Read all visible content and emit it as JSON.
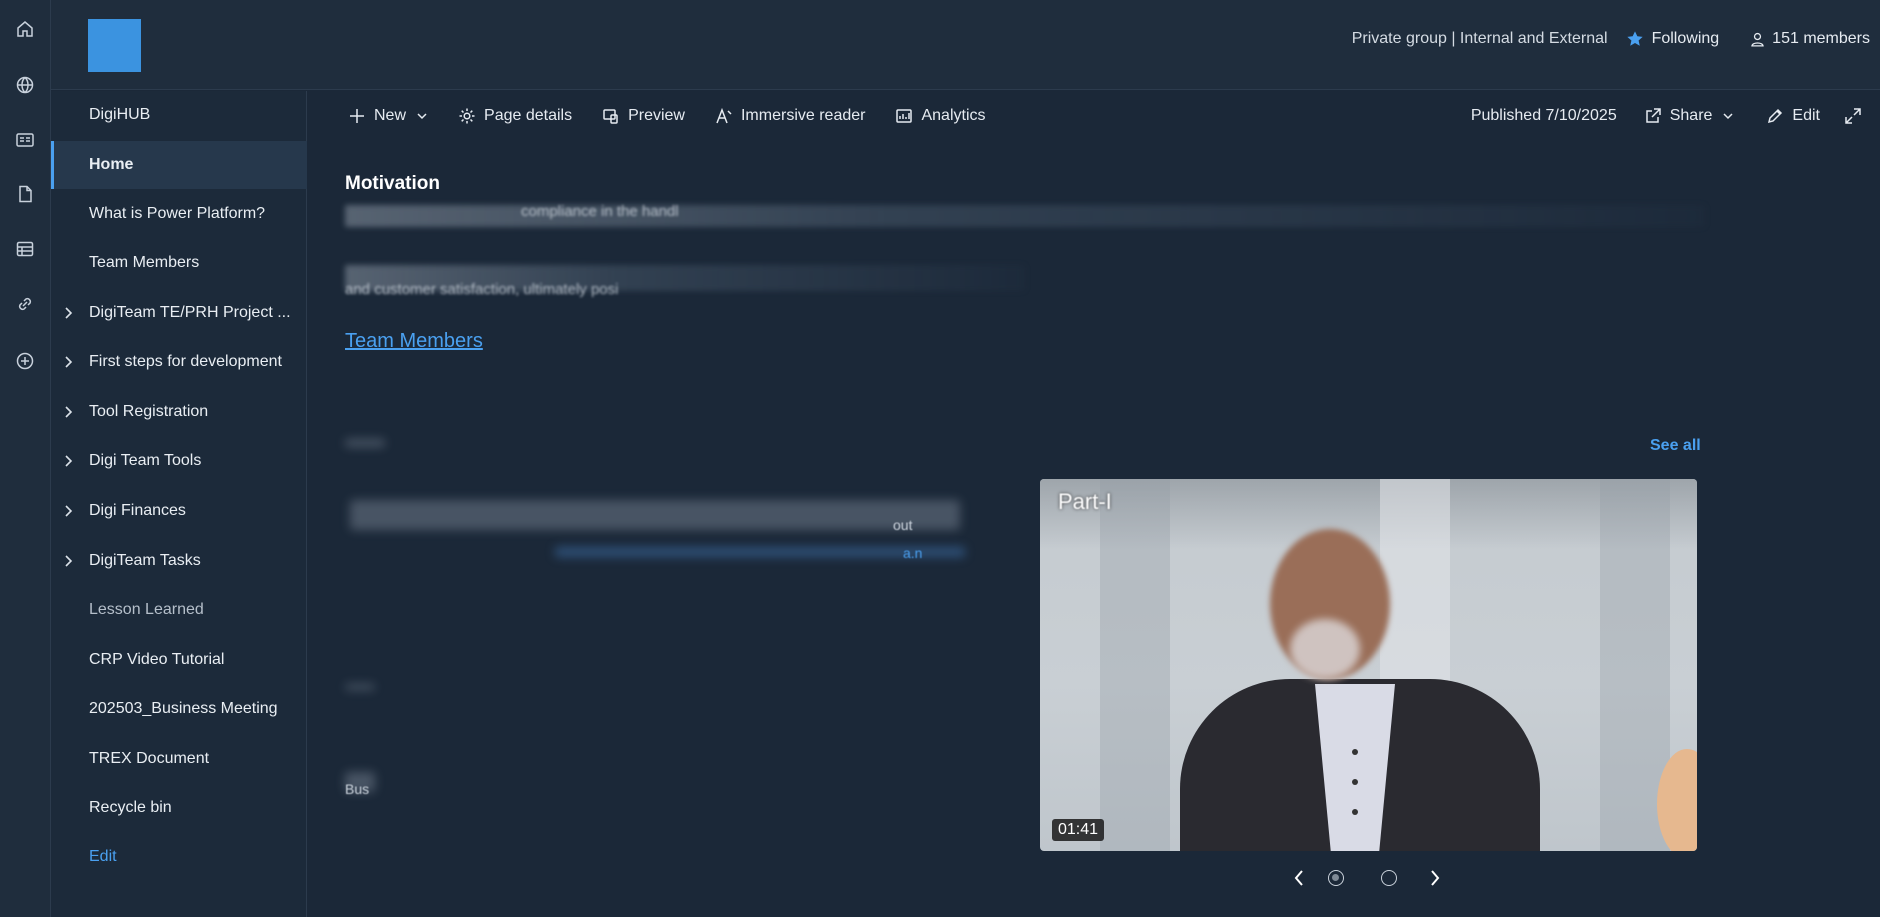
{
  "header": {
    "privacy": "Private group | Internal and External",
    "following_label": "Following",
    "members_label": "151 members"
  },
  "nav": {
    "items": [
      {
        "label": "DigiHUB",
        "expandable": false
      },
      {
        "label": "Home",
        "expandable": false,
        "active": true
      },
      {
        "label": "What is Power Platform?",
        "expandable": false
      },
      {
        "label": "Team Members",
        "expandable": false
      },
      {
        "label": "DigiTeam TE/PRH Project ...",
        "expandable": true
      },
      {
        "label": "First steps for development",
        "expandable": true
      },
      {
        "label": "Tool Registration",
        "expandable": true
      },
      {
        "label": "Digi Team Tools",
        "expandable": true
      },
      {
        "label": "Digi Finances",
        "expandable": true
      },
      {
        "label": "DigiTeam Tasks",
        "expandable": true
      },
      {
        "label": "Lesson Learned",
        "expandable": false
      },
      {
        "label": "CRP Video Tutorial",
        "expandable": false
      },
      {
        "label": "202503_Business Meeting",
        "expandable": false
      },
      {
        "label": "TREX Document",
        "expandable": false
      },
      {
        "label": "Recycle bin",
        "expandable": false
      },
      {
        "label": "Edit",
        "expandable": false
      }
    ]
  },
  "cmdbar": {
    "new_label": "New",
    "page_details_label": "Page details",
    "preview_label": "Preview",
    "immersive_label": "Immersive reader",
    "analytics_label": "Analytics",
    "published_label": "Published 7/10/2025",
    "share_label": "Share",
    "edit_label": "Edit"
  },
  "content": {
    "heading": "Motivation",
    "line1": "compliance in the handl",
    "line2": "and customer satisfaction, ultimately posi",
    "team_link": "Team Members",
    "see_all": "See all",
    "small_a": "out",
    "small_b": "a.n",
    "small_c": "Bus"
  },
  "video": {
    "title": "Part-I",
    "duration": "01:41"
  },
  "colors": {
    "accent": "#4aa0f0",
    "background": "#1b2838",
    "header_bg": "#1f2d3d",
    "nav_bg": "#1c2a3a",
    "logo": "#3b93e0"
  }
}
